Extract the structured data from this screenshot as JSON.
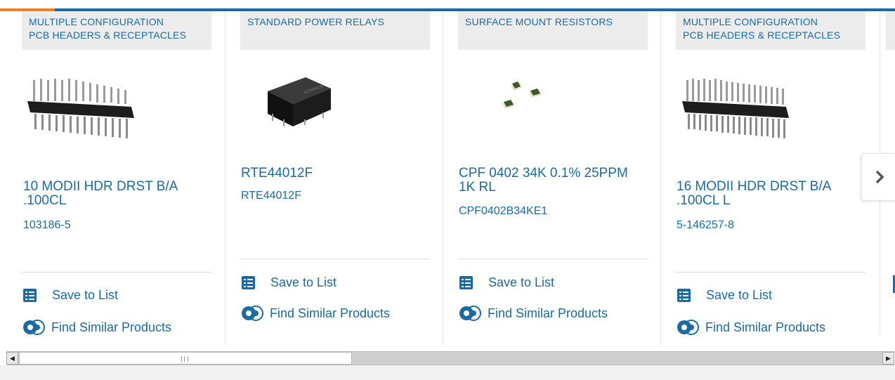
{
  "carousel": {
    "cards": [
      {
        "category_line1": "MULTIPLE CONFIGURATION",
        "category_line2": "PCB HEADERS & RECEPTACLES",
        "title_line1": "10 MODII HDR DRST B/A",
        "title_line2": ".100CL",
        "part_number": "103186-5",
        "image": "pin-header-image",
        "save_label": "Save to List",
        "similar_label": "Find Similar Products"
      },
      {
        "category_line1": "STANDARD POWER RELAYS",
        "category_line2": "",
        "title_line1": "RTE44012F",
        "title_line2": "",
        "part_number": "RTE44012F",
        "image": "relay-image",
        "save_label": "Save to List",
        "similar_label": "Find Similar Products"
      },
      {
        "category_line1": "SURFACE MOUNT RESISTORS",
        "category_line2": "",
        "title_line1": "CPF 0402 34K 0.1% 25PPM",
        "title_line2": "1K RL",
        "part_number": "CPF0402B34KE1",
        "image": "smd-resistor-image",
        "save_label": "Save to List",
        "similar_label": "Find Similar Products"
      },
      {
        "category_line1": "MULTIPLE CONFIGURATION",
        "category_line2": "PCB HEADERS & RECEPTACLES",
        "title_line1": "16 MODII HDR DRST B/A",
        "title_line2": ".100CL L",
        "part_number": "5-146257-8",
        "image": "pin-header-image",
        "save_label": "Save to List",
        "similar_label": "Find Similar Products"
      }
    ],
    "next_icon": "chevron-right-icon"
  },
  "scrollbar": {
    "left_arrow": "◀",
    "right_arrow": "▶",
    "position_fraction": 0
  },
  "colors": {
    "link": "#1a6aa6",
    "accent": "#f07f1a",
    "category_bg": "#ececec"
  }
}
